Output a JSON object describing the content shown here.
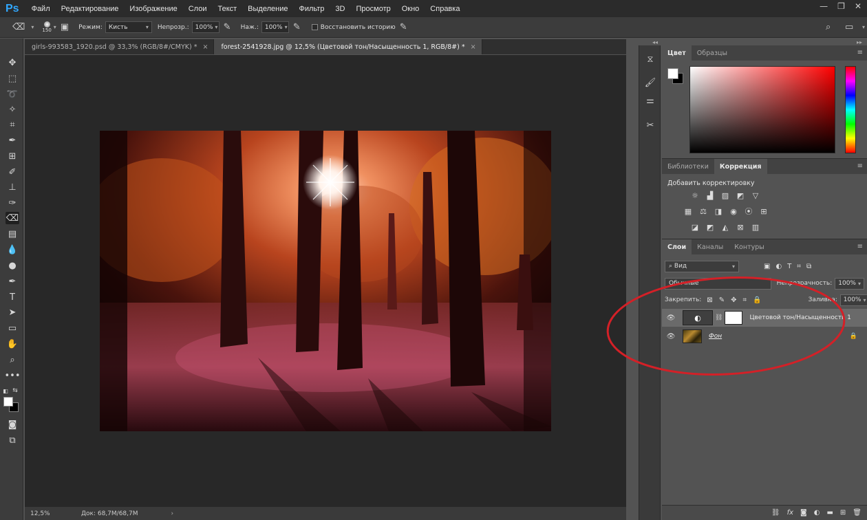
{
  "app": {
    "logo": "Ps"
  },
  "menu": [
    "Файл",
    "Редактирование",
    "Изображение",
    "Слои",
    "Текст",
    "Выделение",
    "Фильтр",
    "3D",
    "Просмотр",
    "Окно",
    "Справка"
  ],
  "window_controls": {
    "minimize": "—",
    "restore": "❐",
    "close": "✕"
  },
  "options": {
    "brush_size": "150",
    "mode_label": "Режим:",
    "mode_value": "Кисть",
    "opacity_label": "Непрозр.:",
    "opacity_value": "100%",
    "pressure_label": "Наж.:",
    "pressure_value": "100%",
    "restore_history_label": "Восстановить историю"
  },
  "tabs": [
    {
      "label": "girls-993583_1920.psd @ 33,3% (RGB/8#/CMYK) *",
      "close": "×"
    },
    {
      "label": "forest-2541928.jpg @ 12,5% (Цветовой тон/Насыщенность 1, RGB/8#) *",
      "close": "×"
    }
  ],
  "status": {
    "zoom": "12,5%",
    "doc": "Док: 68,7M/68,7M",
    "arrow": "›"
  },
  "panels": {
    "color_tabs": [
      "Цвет",
      "Образцы"
    ],
    "adjust_tabs": [
      "Библиотеки",
      "Коррекция"
    ],
    "adjust_title": "Добавить корректировку",
    "layers_tabs": [
      "Слои",
      "Каналы",
      "Контуры"
    ],
    "filter_value": "Вид",
    "blend_mode": "Обычные",
    "opacity_label": "Непрозрачность:",
    "opacity_value": "100%",
    "lock_label": "Закрепить:",
    "fill_label": "Заливка:",
    "fill_value": "100%",
    "menu_icon": "≡"
  },
  "layers": [
    {
      "name": "Цветовой тон/Насыщенность 1",
      "selected": true
    },
    {
      "name": "Фон",
      "selected": false
    }
  ],
  "colors": {
    "accent": "#31a8ff",
    "annotation": "#d42027"
  }
}
